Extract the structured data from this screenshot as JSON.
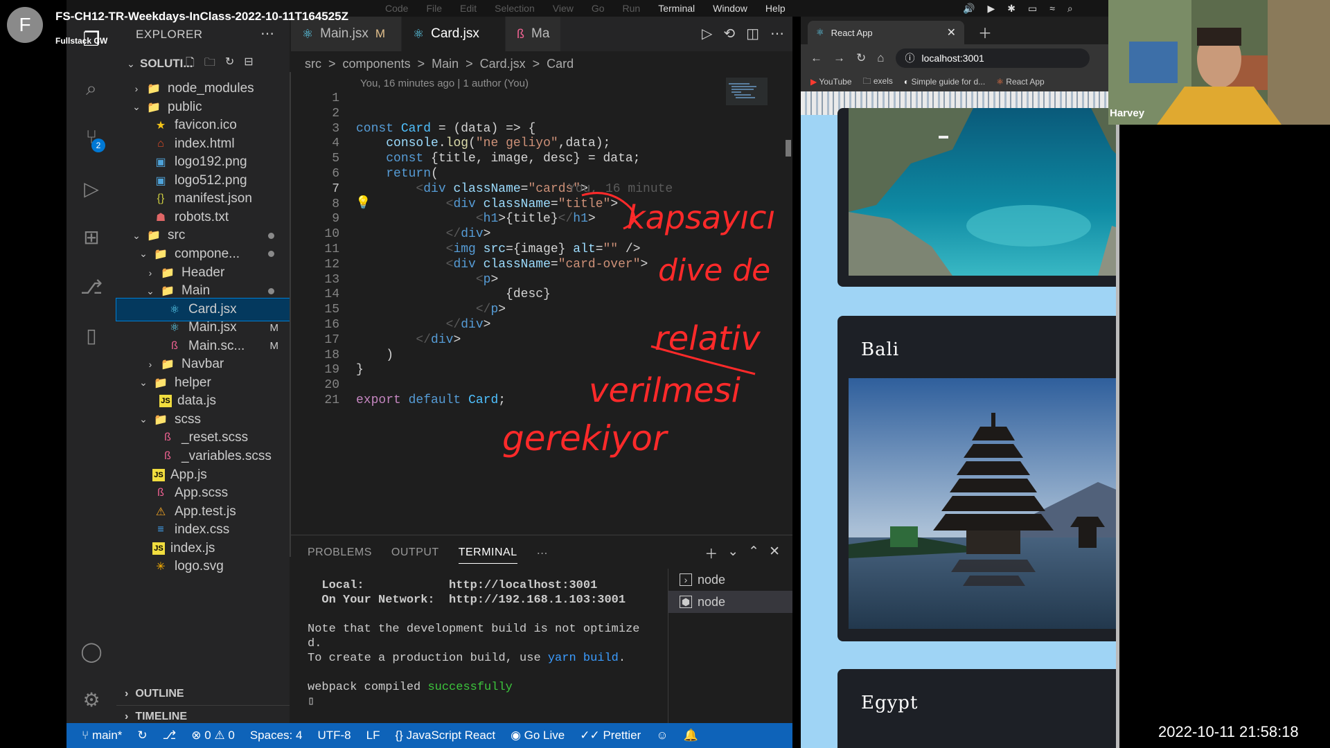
{
  "meeting": {
    "avatar_letter": "F",
    "title": "FS-CH12-TR-Weekdays-InClass-2022-10-11T164525Z",
    "name": "Fullstack CW",
    "participant": "Harvey",
    "timestamp": "2022-10-11  21:58:18"
  },
  "menubar": {
    "items": [
      "Code",
      "File",
      "Edit",
      "Selection",
      "View",
      "Go",
      "Run",
      "Terminal",
      "Window",
      "Help"
    ]
  },
  "explorer": {
    "header": "EXPLORER",
    "root": "SOLUTI...",
    "outline": "OUTLINE",
    "timeline": "TIMELINE",
    "scm_badge": "2",
    "tree": [
      {
        "label": "node_modules",
        "depth": 1,
        "type": "folder",
        "open": false
      },
      {
        "label": "public",
        "depth": 1,
        "type": "folder",
        "open": true
      },
      {
        "label": "favicon.ico",
        "depth": 2,
        "type": "star"
      },
      {
        "label": "index.html",
        "depth": 2,
        "type": "html"
      },
      {
        "label": "logo192.png",
        "depth": 2,
        "type": "img"
      },
      {
        "label": "logo512.png",
        "depth": 2,
        "type": "img"
      },
      {
        "label": "manifest.json",
        "depth": 2,
        "type": "json"
      },
      {
        "label": "robots.txt",
        "depth": 2,
        "type": "robot"
      },
      {
        "label": "src",
        "depth": 1,
        "type": "folder",
        "open": true,
        "dot": true
      },
      {
        "label": "compone...",
        "depth": 2,
        "type": "folder",
        "open": true,
        "dot": true
      },
      {
        "label": "Header",
        "depth": 3,
        "type": "folder",
        "open": false
      },
      {
        "label": "Main",
        "depth": 3,
        "type": "folder",
        "open": true,
        "dot": true
      },
      {
        "label": "Card.jsx",
        "depth": 4,
        "type": "react",
        "selected": true
      },
      {
        "label": "Main.jsx",
        "depth": 4,
        "type": "react",
        "mark": "M"
      },
      {
        "label": "Main.sc...",
        "depth": 4,
        "type": "sass",
        "mark": "M"
      },
      {
        "label": "Navbar",
        "depth": 3,
        "type": "folder",
        "open": false
      },
      {
        "label": "helper",
        "depth": 2,
        "type": "folder",
        "open": true
      },
      {
        "label": "data.js",
        "depth": 3,
        "type": "js"
      },
      {
        "label": "scss",
        "depth": 2,
        "type": "folder",
        "open": true
      },
      {
        "label": "_reset.scss",
        "depth": 3,
        "type": "sass"
      },
      {
        "label": "_variables.scss",
        "depth": 3,
        "type": "sass"
      },
      {
        "label": "App.js",
        "depth": 2,
        "type": "js"
      },
      {
        "label": "App.scss",
        "depth": 2,
        "type": "sass"
      },
      {
        "label": "App.test.js",
        "depth": 2,
        "type": "test"
      },
      {
        "label": "index.css",
        "depth": 2,
        "type": "css"
      },
      {
        "label": "index.js",
        "depth": 2,
        "type": "js"
      },
      {
        "label": "logo.svg",
        "depth": 2,
        "type": "svg"
      }
    ]
  },
  "editor": {
    "tabs": [
      {
        "label": "Main.jsx",
        "mark": "M",
        "icon": "react"
      },
      {
        "label": "Card.jsx",
        "active": true,
        "icon": "react"
      },
      {
        "label": "Ma",
        "icon": "sass"
      }
    ],
    "breadcrumb": [
      "src",
      ">",
      "components",
      ">",
      "Main",
      ">",
      "Card.jsx",
      ">",
      "Card"
    ],
    "blame": "You, 16 minutes ago | 1 author (You)",
    "inline_blame": "You, 16 minute",
    "current_line": 7,
    "lines": [
      "",
      "",
      "const Card = (data) => {",
      "    console.log(\"ne geliyo\",data);",
      "    const {title, image, desc} = data;",
      "    return(",
      "        <div className=\"cards\">",
      "            <div className=\"title\">",
      "                <h1>{title}</h1>",
      "            </div>",
      "            <img src={image} alt=\"\" />",
      "            <div className=\"card-over\">",
      "                <p>",
      "                    {desc}",
      "                </p>",
      "            </div>",
      "        </div>",
      "    )",
      "}",
      "",
      "export default Card;"
    ],
    "annotation_words": [
      "kapsayıcı",
      "dive de",
      "relativ",
      "verilmesi",
      "gerekiyor"
    ]
  },
  "panel": {
    "tabs": [
      "PROBLEMS",
      "OUTPUT",
      "TERMINAL"
    ],
    "active_tab": "TERMINAL",
    "terminal_lines": [
      "  Local:            http://localhost:3001",
      "  On Your Network:  http://192.168.1.103:3001",
      "",
      "Note that the development build is not optimize",
      "d.",
      "To create a production build, use yarn build.",
      "",
      "webpack compiled successfully"
    ],
    "terminals": [
      "node",
      "node"
    ]
  },
  "statusbar": {
    "branch": "main*",
    "errors": "0",
    "warnings": "0",
    "spaces": "Spaces: 4",
    "encoding": "UTF-8",
    "eol": "LF",
    "language": "JavaScript React",
    "golive": "Go Live",
    "prettier": "Prettier"
  },
  "browser": {
    "tab_title": "React App",
    "url": "localhost:3001",
    "bookmarks": [
      "YouTube",
      "exels",
      "Simple guide for d...",
      "React App"
    ],
    "cards": [
      "Bali",
      "Egypt"
    ],
    "page_bg": "#9fd4f5",
    "card_bg": "#1d2026"
  },
  "colors": {
    "accent": "#0e63b9",
    "ink": "#ff2a2a"
  }
}
